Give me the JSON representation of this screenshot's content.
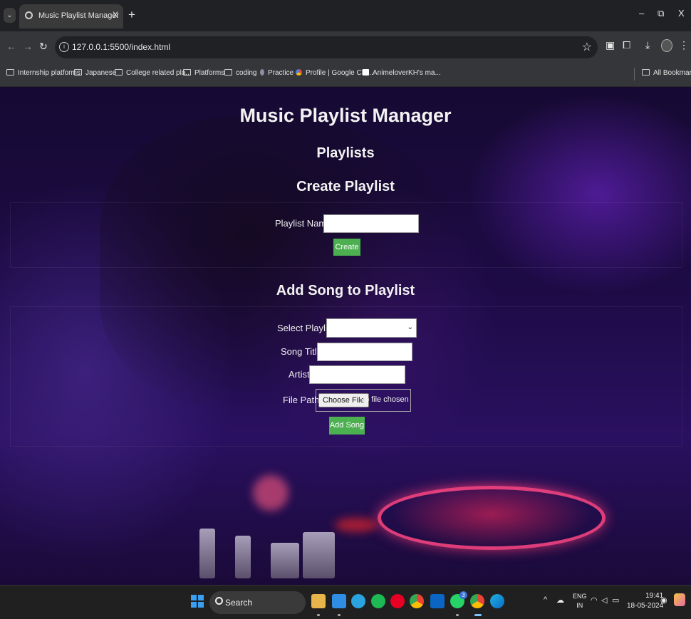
{
  "browser": {
    "tab_title": "Music Playlist Manager",
    "tab_close": "X",
    "new_tab": "+",
    "window_controls": {
      "minimize": "–",
      "restore": "⧉",
      "close": "X"
    },
    "url": "127.0.0.1:5500/index.html",
    "bookmarks": [
      {
        "label": "Internship platforms",
        "icon": "folder-icon"
      },
      {
        "label": "Japanese",
        "icon": "folder-icon"
      },
      {
        "label": "College related pla...",
        "icon": "folder-icon"
      },
      {
        "label": "Platforms",
        "icon": "folder-icon"
      },
      {
        "label": "coding",
        "icon": "folder-icon"
      },
      {
        "label": "Practice",
        "icon": "mic-icon"
      },
      {
        "label": "Profile | Google Clo...",
        "icon": "google-cloud-icon"
      },
      {
        "label": "AnimeloverKH's ma...",
        "icon": "a-site-icon"
      }
    ],
    "all_bookmarks": "All Bookmarks"
  },
  "page": {
    "title": "Music Playlist Manager",
    "playlists_heading": "Playlists",
    "create": {
      "heading": "Create Playlist",
      "name_label": "Playlist Name:",
      "name_value": "",
      "button": "Create"
    },
    "add_song": {
      "heading": "Add Song to Playlist",
      "select_label": "Select Playlist:",
      "selected_value": "",
      "song_title_label": "Song Title:",
      "song_title_value": "",
      "artist_label": "Artist:",
      "artist_value": "",
      "file_path_label": "File Path:",
      "choose_file_button": "Choose File",
      "no_file": "No file chosen",
      "button": "Add Song"
    },
    "colors": {
      "button_green": "#4caf50",
      "background_purple": "#1d0b45"
    }
  },
  "taskbar": {
    "search": "Search",
    "whatsapp_badge": "3",
    "lang_top": "ENG",
    "lang_bottom": "IN",
    "time": "19:41",
    "date": "18-05-2024"
  }
}
